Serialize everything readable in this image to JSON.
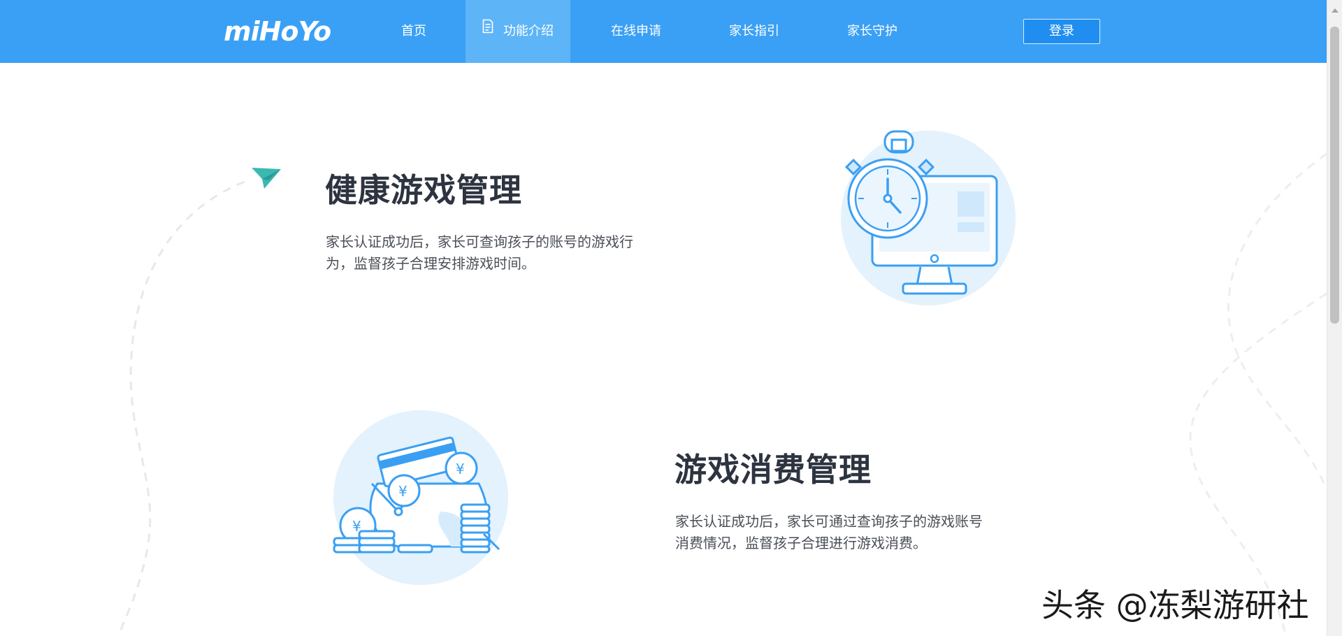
{
  "nav": {
    "logo": "miHoYo",
    "items": [
      {
        "label": "首页"
      },
      {
        "label": "功能介绍"
      },
      {
        "label": "在线申请"
      },
      {
        "label": "家长指引"
      },
      {
        "label": "家长守护"
      }
    ],
    "active_index": 1,
    "login_label": "登录"
  },
  "sections": [
    {
      "title": "健康游戏管理",
      "desc_line1": "家长认证成功后，家长可查询孩子的账号的游戏行",
      "desc_line2": "为，监督孩子合理安排游戏时间。",
      "icon": "stopwatch-monitor-illustration"
    },
    {
      "title": "游戏消费管理",
      "desc_line1": "家长认证成功后，家长可通过查询孩子的游戏账号",
      "desc_line2": "消费情况，监督孩子合理进行游戏消费。",
      "icon": "wallet-coins-illustration"
    }
  ],
  "watermark": "头条 @冻梨游研社",
  "colors": {
    "nav_bg": "#3aa0f5",
    "nav_active": "#5db4f7",
    "login_bg": "#1f8ef0",
    "accent_teal": "#3bb8b0",
    "illus_circle": "#e3f2fd",
    "illus_stroke": "#3a9ff3"
  }
}
